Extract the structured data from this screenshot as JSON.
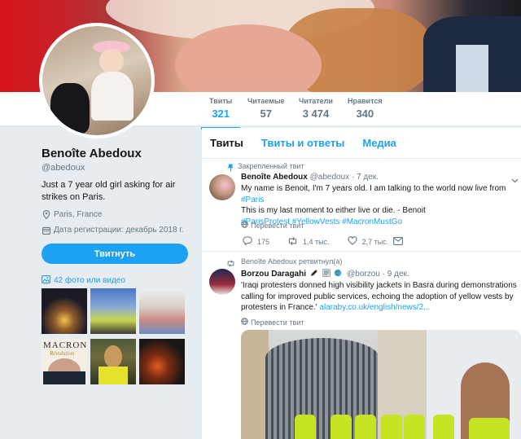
{
  "colors": {
    "accent": "#1da1f2",
    "muted": "#657786",
    "text": "#14171a",
    "page_bg": "#e6ecf0"
  },
  "stats": [
    {
      "label": "Твиты",
      "value": "321"
    },
    {
      "label": "Читаемые",
      "value": "57"
    },
    {
      "label": "Читатели",
      "value": "3 474"
    },
    {
      "label": "Нравится",
      "value": "340"
    }
  ],
  "profile": {
    "name": "Benoîte Abedoux",
    "handle": "@abedoux",
    "bio": "Just a 7 year old girl asking for air strikes on Paris.",
    "location": "Paris, France",
    "joined": "Дата регистрации: декабрь 2018 г.",
    "tweet_button": "Твитнуть",
    "media_link": "42 фото или видео",
    "thumbs": [
      "t1",
      "t2",
      "t3",
      "t4",
      "t5",
      "t6"
    ],
    "thumb4_title": "MACRON",
    "thumb4_subtitle": "Révolution"
  },
  "tabs": [
    {
      "label": "Твиты"
    },
    {
      "label": "Твиты и ответы"
    },
    {
      "label": "Медиа"
    }
  ],
  "tweet1": {
    "pinned_label": "Закрепленный твит",
    "author": "Benoîte Abedoux",
    "handle": "@abedoux",
    "date": "· 7 дек.",
    "line1": "My name is Benoit, I'm 7 years old. I am talking to the world now live from ",
    "line1_tag": "#Paris",
    "line2": "This is my last moment to either live or die. - Benoit",
    "line3": "#ParisProtest #YellowVests #MacronMustGo",
    "translate": "Перевести твит",
    "replies": "175",
    "retweets": "1,4 тыс.",
    "likes": "2,7 тыс."
  },
  "tweet2": {
    "retweet_label": "Benoîte Abedoux ретвитнул(а)",
    "author": "Borzou Daragahi",
    "handle": "@borzou",
    "date": "· 9 дек.",
    "text": "'Iraqi protesters donned high visibility jackets in Basra during demonstrations calling for improved public services, echoing the adoption of yellow vests by protesters in France.' ",
    "link": "alaraby.co.uk/english/news/2...",
    "translate": "Перевести твит"
  },
  "icons": [
    "pin-icon",
    "location-icon",
    "calendar-icon",
    "image-icon",
    "translate-icon",
    "reply-icon",
    "retweet-icon",
    "like-icon",
    "dm-icon"
  ]
}
